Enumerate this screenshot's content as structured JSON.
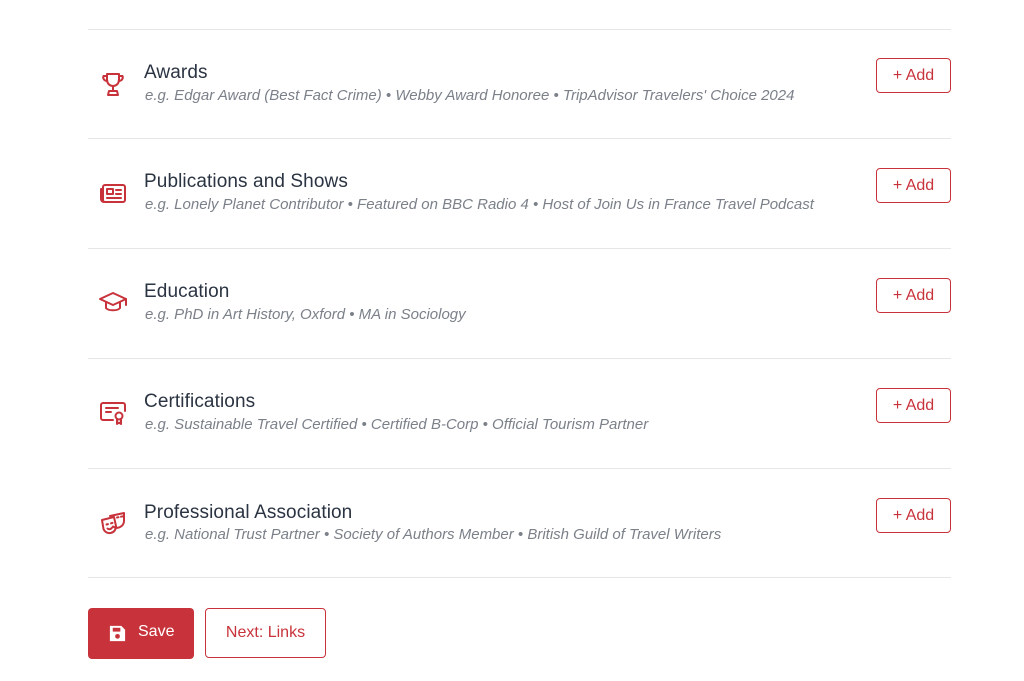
{
  "colors": {
    "accent": "#c8333b",
    "title_text": "#2b3442",
    "muted_text": "#7b8089",
    "divider": "#e6e6e6"
  },
  "sections": [
    {
      "title": "Awards",
      "example": "e.g. Edgar Award (Best Fact Crime) • Webby Award Honoree • TripAdvisor Travelers' Choice 2024",
      "icon": "trophy-icon",
      "add_label": "+ Add"
    },
    {
      "title": "Publications and Shows",
      "example": "e.g. Lonely Planet Contributor • Featured on BBC Radio 4 • Host of Join Us in France Travel Podcast",
      "icon": "newspaper-icon",
      "add_label": "+ Add"
    },
    {
      "title": "Education",
      "example": "e.g. PhD in Art History, Oxford • MA in Sociology",
      "icon": "graduation-cap-icon",
      "add_label": "+ Add"
    },
    {
      "title": "Certifications",
      "example": "e.g. Sustainable Travel Certified • Certified B-Corp • Official Tourism Partner",
      "icon": "certificate-icon",
      "add_label": "+ Add"
    },
    {
      "title": "Professional Association",
      "example": "e.g. National Trust Partner • Society of Authors Member • British Guild of Travel Writers",
      "icon": "theater-masks-icon",
      "add_label": "+ Add"
    }
  ],
  "footer": {
    "save_label": "Save",
    "save_icon": "floppy-disk-icon",
    "next_label": "Next: Links"
  }
}
